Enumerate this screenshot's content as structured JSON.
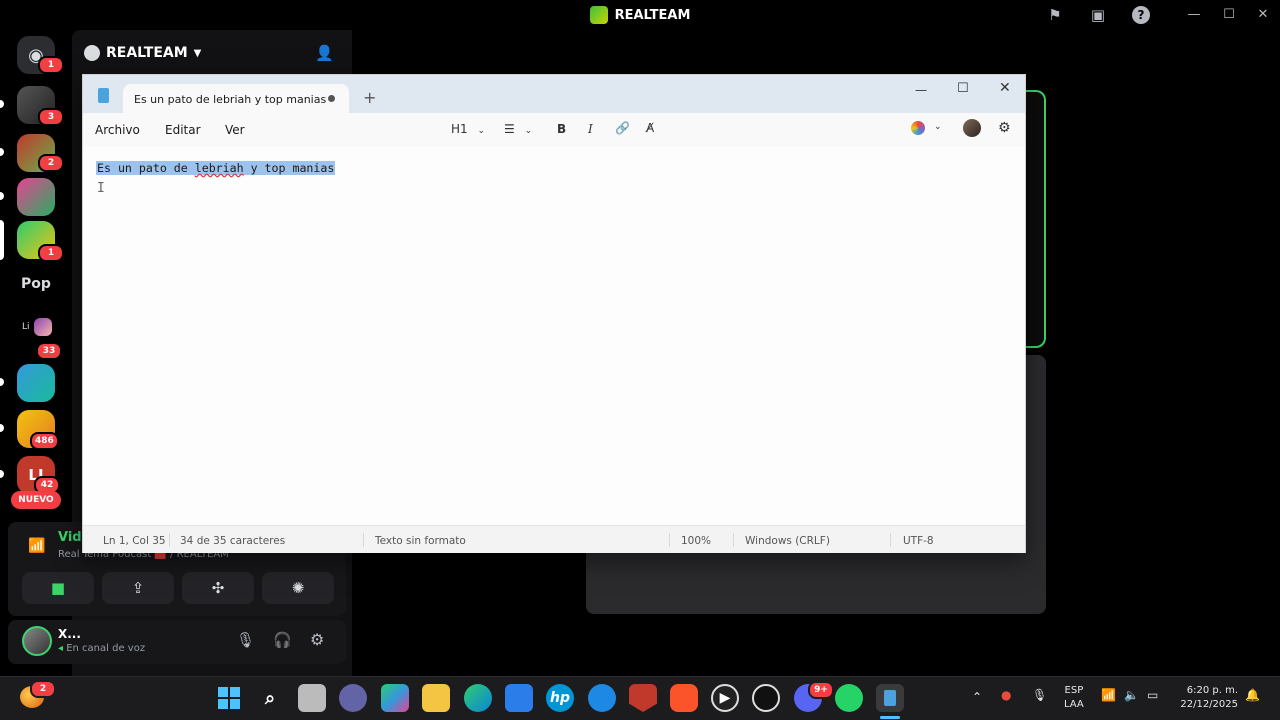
{
  "discord": {
    "window_title": "REALTEAM",
    "server_name": "REALTEAM",
    "rail": {
      "home_badge": "1",
      "servers": [
        {
          "name": "server-1",
          "badge": "3"
        },
        {
          "name": "server-2",
          "badge": "2"
        },
        {
          "name": "server-3",
          "badge": ""
        },
        {
          "name": "server-4",
          "badge": "1"
        },
        {
          "name": "Pop",
          "badge": ""
        },
        {
          "name": "Li",
          "badge": "33"
        },
        {
          "name": "server-7",
          "badge": ""
        },
        {
          "name": "server-8",
          "badge": "486"
        },
        {
          "name": "LI",
          "badge": "42"
        }
      ],
      "new_label": "NUEVO"
    },
    "voice": {
      "status": "Vid",
      "channel": "Real Tema Podcast 🟥 / REALTEAM"
    },
    "user": {
      "name": "X...",
      "status": "En canal de voz"
    }
  },
  "notepad": {
    "tab_title": "Es un pato de lebriah y top manias",
    "menu": {
      "file": "Archivo",
      "edit": "Editar",
      "view": "Ver"
    },
    "heading": "H1",
    "bold": "B",
    "italic": "I",
    "content": {
      "before": "Es un pato de ",
      "misspelled": "lebriah",
      "after": " y top manias"
    },
    "status": {
      "position": "Ln 1, Col 35",
      "chars": "34 de 35 caracteres",
      "format": "Texto sin formato",
      "zoom": "100%",
      "line_ending": "Windows (CRLF)",
      "encoding": "UTF-8"
    }
  },
  "taskbar": {
    "lang_top": "ESP",
    "lang_bottom": "LAA",
    "time": "6:20 p. m.",
    "date": "22/12/2025",
    "weather_badge": "2",
    "discord_badge": "9+"
  }
}
